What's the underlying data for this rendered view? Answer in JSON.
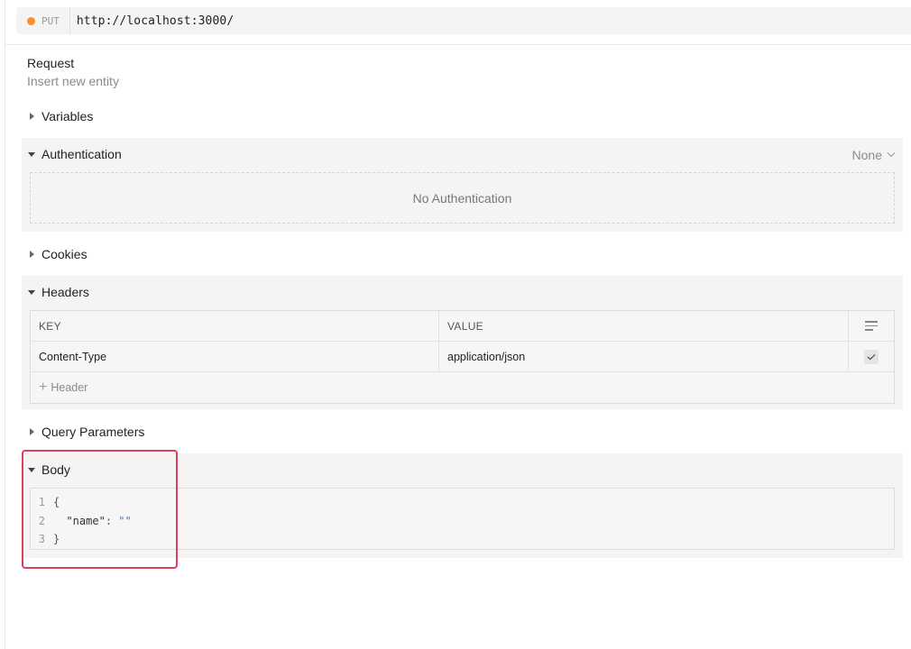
{
  "request": {
    "method": "PUT",
    "method_color": "#f5922e",
    "url": "http://localhost:3000/",
    "title": "Request",
    "description": "Insert new entity"
  },
  "sections": {
    "variables": "Variables",
    "authentication": {
      "label": "Authentication",
      "selected_type": "None",
      "empty_message": "No Authentication"
    },
    "cookies": "Cookies",
    "headers": {
      "label": "Headers",
      "columns": [
        "KEY",
        "VALUE"
      ],
      "rows": [
        {
          "key": "Content-Type",
          "value": "application/json",
          "enabled": true
        }
      ],
      "add_label": "Header"
    },
    "query_parameters": "Query Parameters",
    "body": {
      "label": "Body",
      "lines": [
        {
          "num": "1",
          "text": "{"
        },
        {
          "num": "2",
          "key": "\"name\"",
          "sep": ": ",
          "value": "\"\""
        },
        {
          "num": "3",
          "text": "}"
        }
      ]
    }
  },
  "icons": {
    "method_dot": "status-dot",
    "auth_dropdown": "chevron-down-icon",
    "headers_menu": "menu-icon",
    "header_checkbox": "checkmark-icon",
    "add_header": "plus-icon"
  },
  "colors": {
    "highlight": "#e03e5f",
    "string": "#3d7dd6"
  }
}
